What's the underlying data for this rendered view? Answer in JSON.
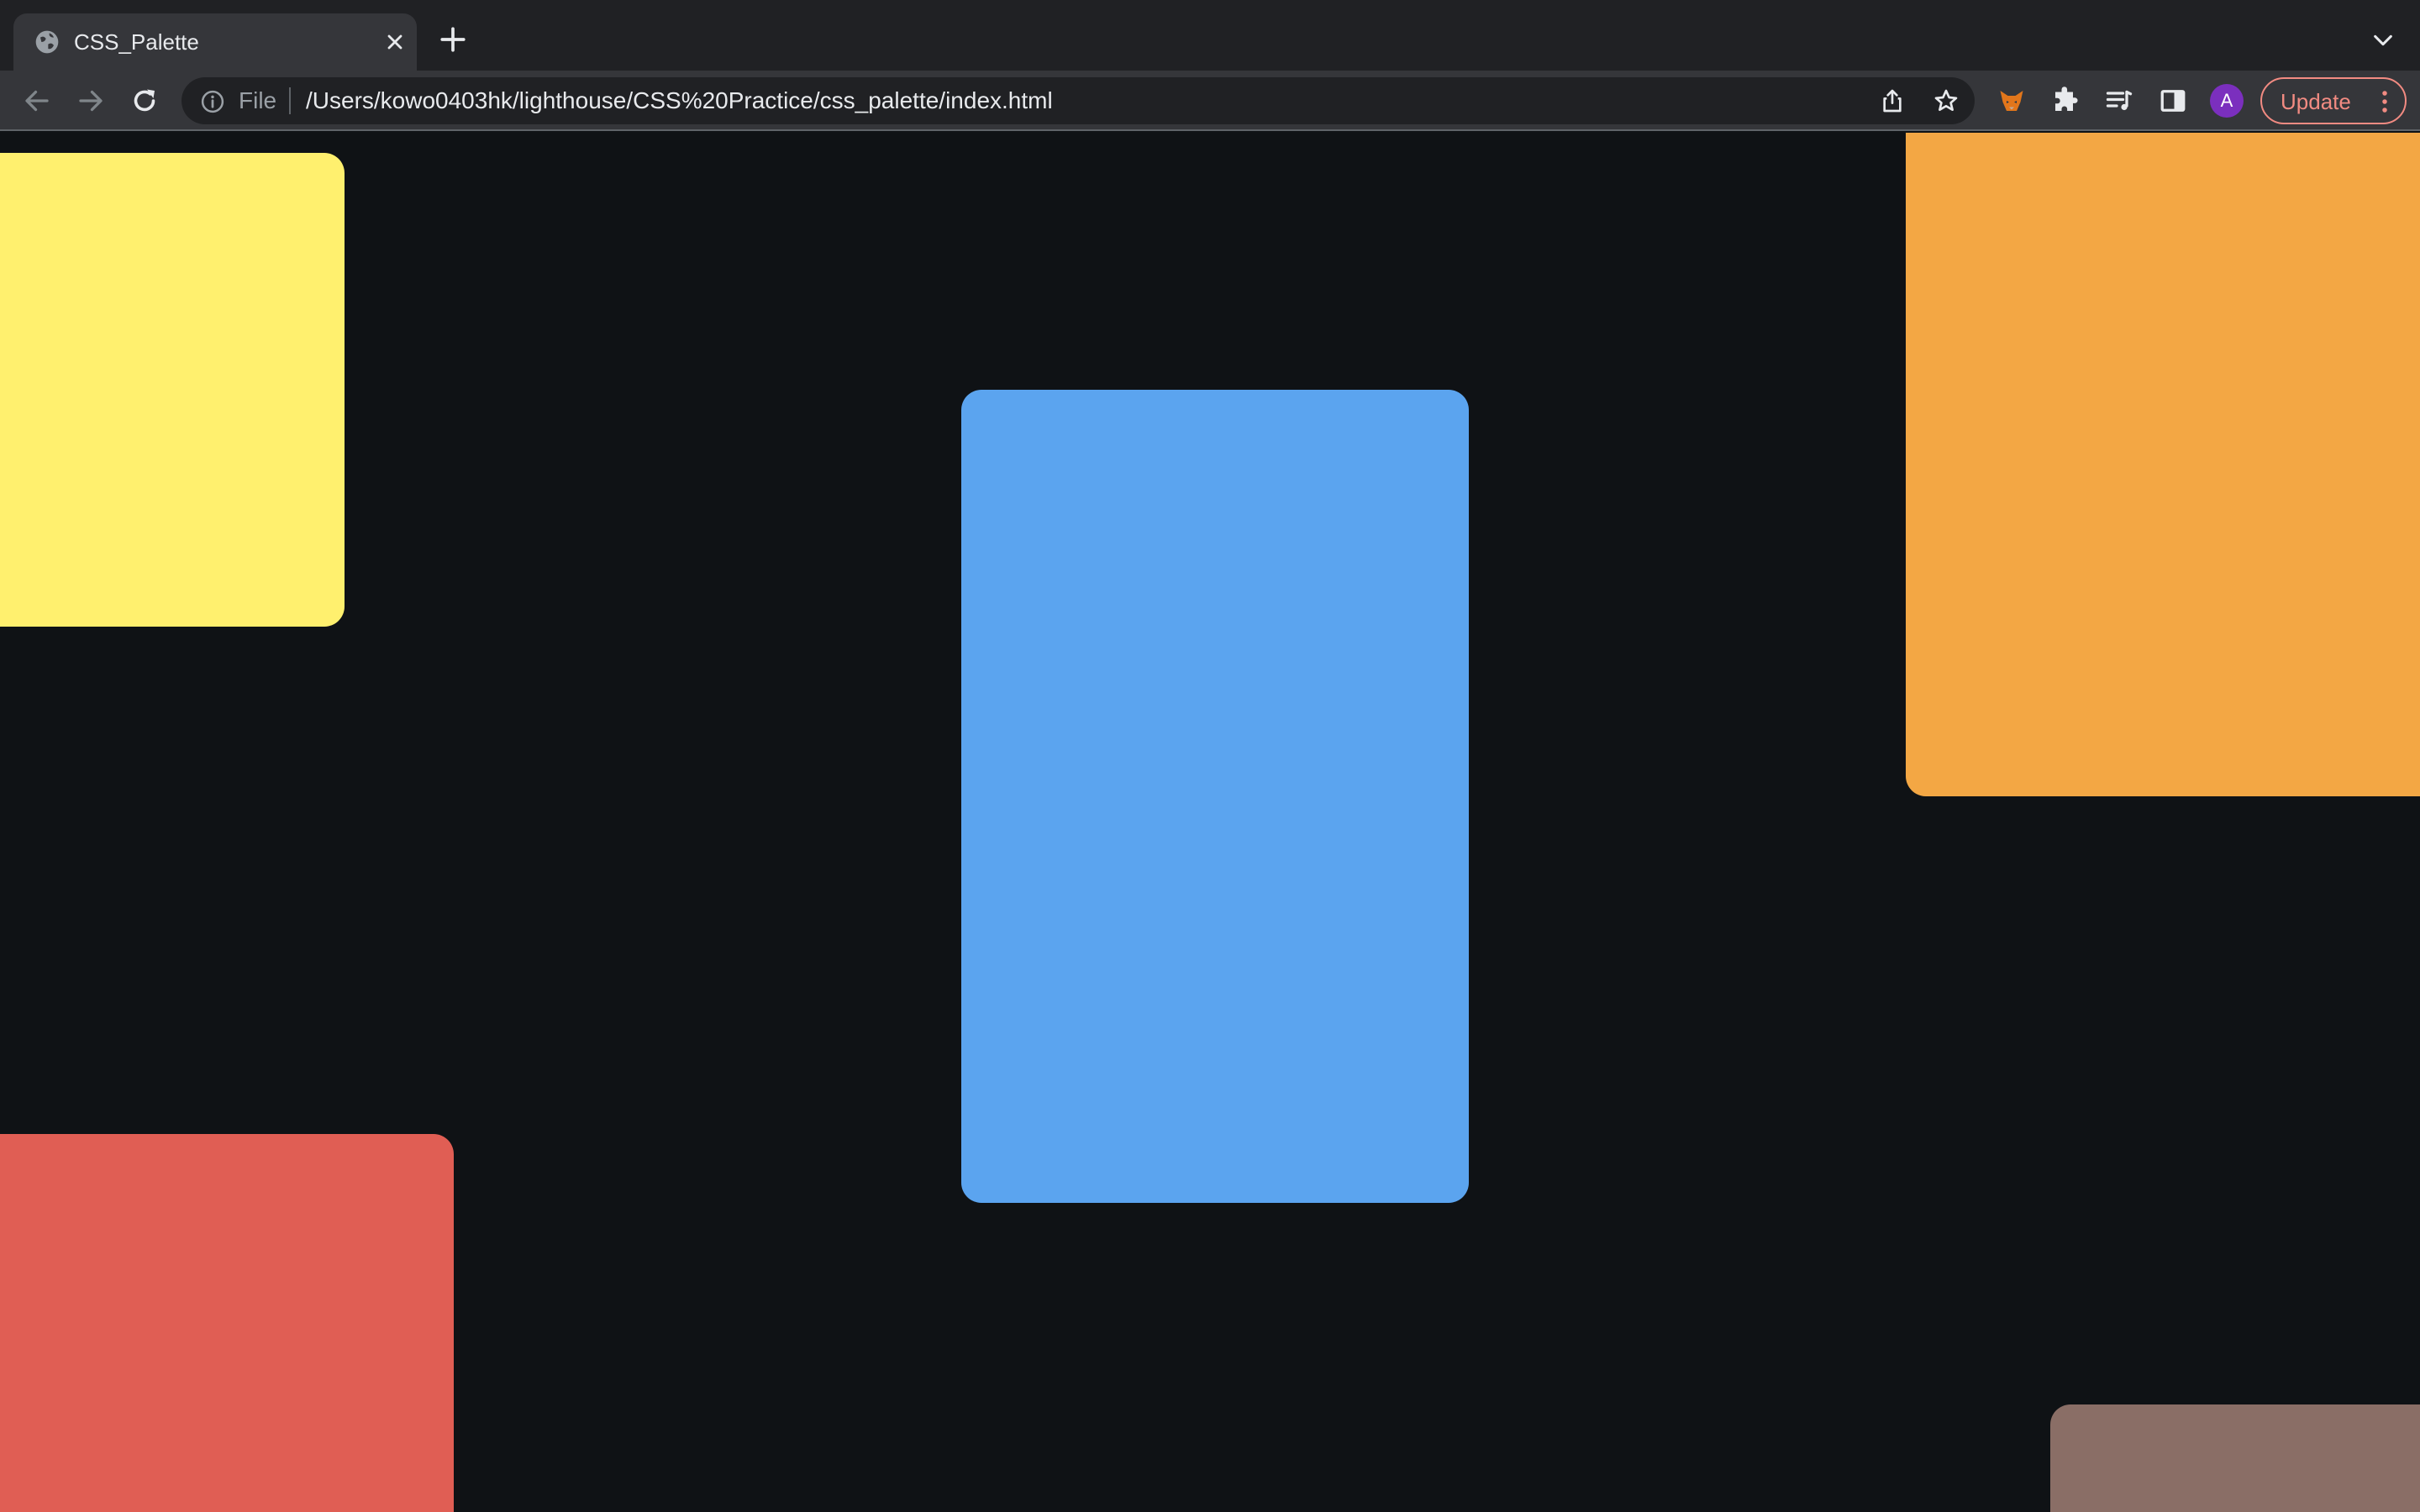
{
  "browser": {
    "tab": {
      "title": "CSS_Palette",
      "favicon": "globe-icon"
    },
    "toolbar": {
      "back": "arrow-left-icon",
      "forward": "arrow-right-icon",
      "reload": "reload-icon"
    },
    "omnibox": {
      "scheme_label": "File",
      "url": "/Users/kowo0403hk/lighthouse/CSS%20Practice/css_palette/index.html"
    },
    "profile_initial": "A",
    "update_label": "Update"
  },
  "palette": {
    "swatches": [
      {
        "name": "yellow",
        "color": "#fff06e"
      },
      {
        "name": "blue",
        "color": "#5ba4ef"
      },
      {
        "name": "orange",
        "color": "#f3a744"
      },
      {
        "name": "red",
        "color": "#e05e54"
      },
      {
        "name": "brown",
        "color": "#8a6e66"
      }
    ]
  },
  "theme": {
    "page_background": "#0f1215",
    "accent_update": "#f28b82",
    "avatar_color": "#7b2fbe"
  }
}
